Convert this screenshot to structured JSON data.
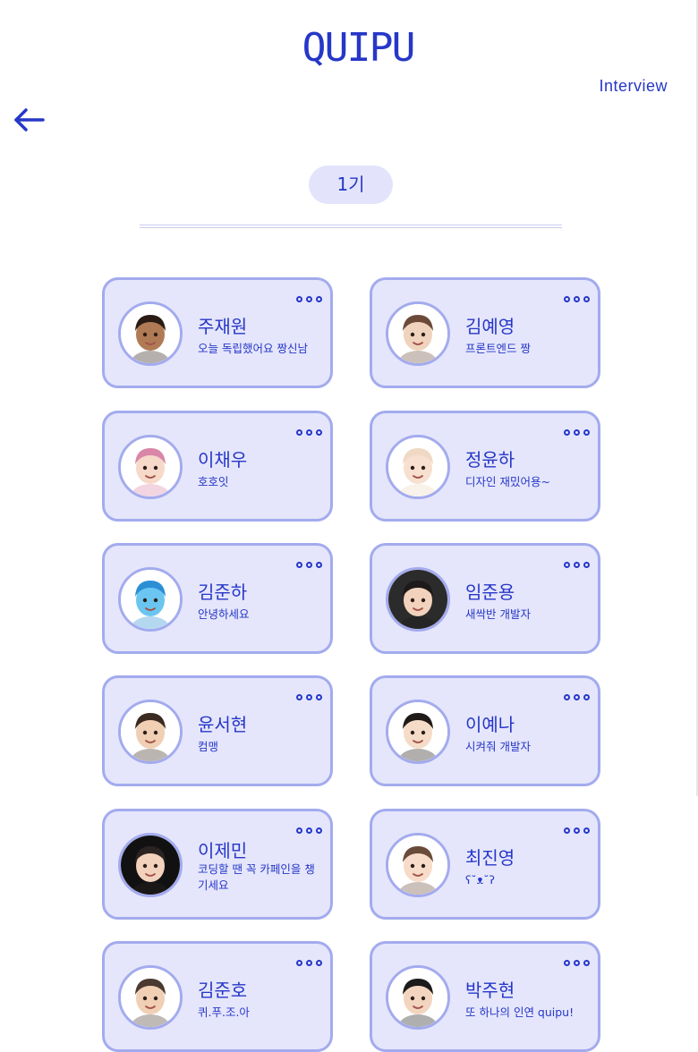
{
  "header": {
    "logo": "QUIPU",
    "interview_link": "Interview",
    "back_icon": "arrow-left-icon"
  },
  "generation": {
    "label": "1기"
  },
  "members": [
    {
      "name": "주재원",
      "status": "오늘 독립했어요 짱신남",
      "avatar": {
        "face": "#b07a55",
        "hair": "#2a1c14",
        "bg": "#ffffff"
      }
    },
    {
      "name": "김예영",
      "status": "프론트엔드 짱",
      "avatar": {
        "face": "#f0d3bd",
        "hair": "#6b4a3a",
        "bg": "#ffffff"
      }
    },
    {
      "name": "이채우",
      "status": "호호잇",
      "avatar": {
        "face": "#f6d9c9",
        "hair": "#d986a8",
        "bg": "#ffffff"
      }
    },
    {
      "name": "정윤하",
      "status": "디자인 재밌어용~",
      "avatar": {
        "face": "#f7e0d0",
        "hair": "#efd9c4",
        "bg": "#ffffff"
      }
    },
    {
      "name": "김준하",
      "status": "안녕하세요",
      "avatar": {
        "face": "#6ac6f0",
        "hair": "#2b8fd6",
        "bg": "#ffffff"
      }
    },
    {
      "name": "임준용",
      "status": "새싹반 개발자",
      "avatar": {
        "face": "#f2d2bc",
        "hair": "#1e1a1a",
        "bg": "#2b2b2b"
      }
    },
    {
      "name": "윤서현",
      "status": "컴맹",
      "avatar": {
        "face": "#f0cfb4",
        "hair": "#3b2a20",
        "bg": "#ffffff"
      }
    },
    {
      "name": "이예나",
      "status": "시켜줘 개발자",
      "avatar": {
        "face": "#f5dcc8",
        "hair": "#1f1a18",
        "bg": "#ffffff"
      }
    },
    {
      "name": "이제민",
      "status": "코딩할 땐 꼭 카페인을 챙기세요",
      "avatar": {
        "face": "#f2d2bc",
        "hair": "#2a2322",
        "bg": "#111111"
      }
    },
    {
      "name": "최진영",
      "status": "ʕ˘ᴥ˘ʔ",
      "avatar": {
        "face": "#f6dcc9",
        "hair": "#6a4a38",
        "bg": "#ffffff"
      }
    },
    {
      "name": "김준호",
      "status": "퀴.푸.조.아",
      "avatar": {
        "face": "#f0cfb4",
        "hair": "#4a3a30",
        "bg": "#ffffff"
      }
    },
    {
      "name": "박주현",
      "status": "또 하나의 인연 quipu!",
      "avatar": {
        "face": "#f3d5bf",
        "hair": "#1c1a1a",
        "bg": "#ffffff"
      }
    }
  ]
}
